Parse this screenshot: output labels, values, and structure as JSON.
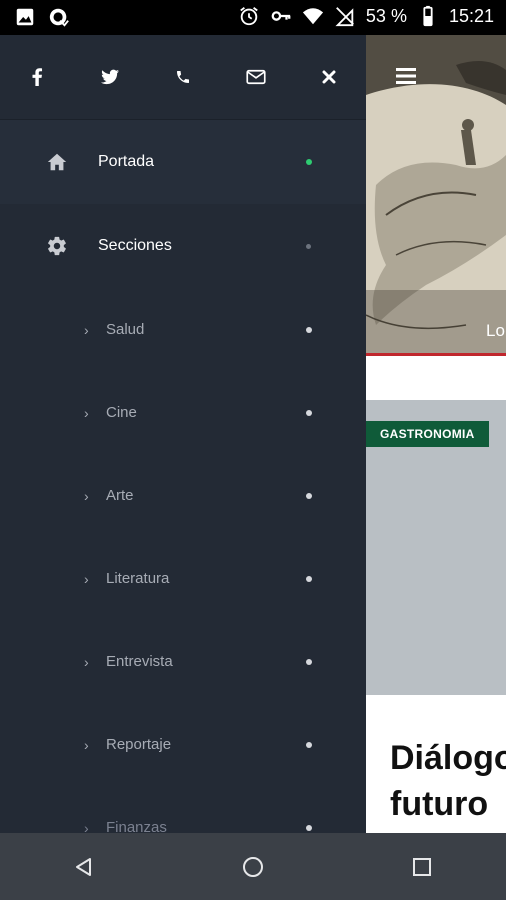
{
  "status_bar": {
    "battery_text": "53 %",
    "time": "15:21",
    "left_icons": [
      "image-icon",
      "app-notification-icon"
    ],
    "right_icons": [
      "alarm-icon",
      "key-icon",
      "wifi-icon",
      "no-sim-icon",
      "battery-icon"
    ]
  },
  "drawer": {
    "social_icons": [
      "facebook-icon",
      "twitter-icon",
      "phone-icon",
      "mail-icon",
      "close-icon"
    ],
    "items": [
      {
        "label": "Portada",
        "icon": "home-icon",
        "dot_color": "#2ecc71"
      },
      {
        "label": "Secciones",
        "icon": "gear-icon"
      }
    ],
    "sub_items": [
      {
        "label": "Salud"
      },
      {
        "label": "Cine"
      },
      {
        "label": "Arte"
      },
      {
        "label": "Literatura"
      },
      {
        "label": "Entrevista"
      },
      {
        "label": "Reportaje"
      },
      {
        "label": "Finanzas"
      }
    ]
  },
  "peek": {
    "header_partial_text": "Lo",
    "badge": "GASTRONOMIA",
    "title_line1": "Diálogo",
    "title_line2": "futuro"
  },
  "colors": {
    "drawer_bg": "#232a35",
    "badge_bg": "#0f5b39",
    "accent_green_dot": "#2ecc71",
    "red_line": "#c0272d"
  }
}
